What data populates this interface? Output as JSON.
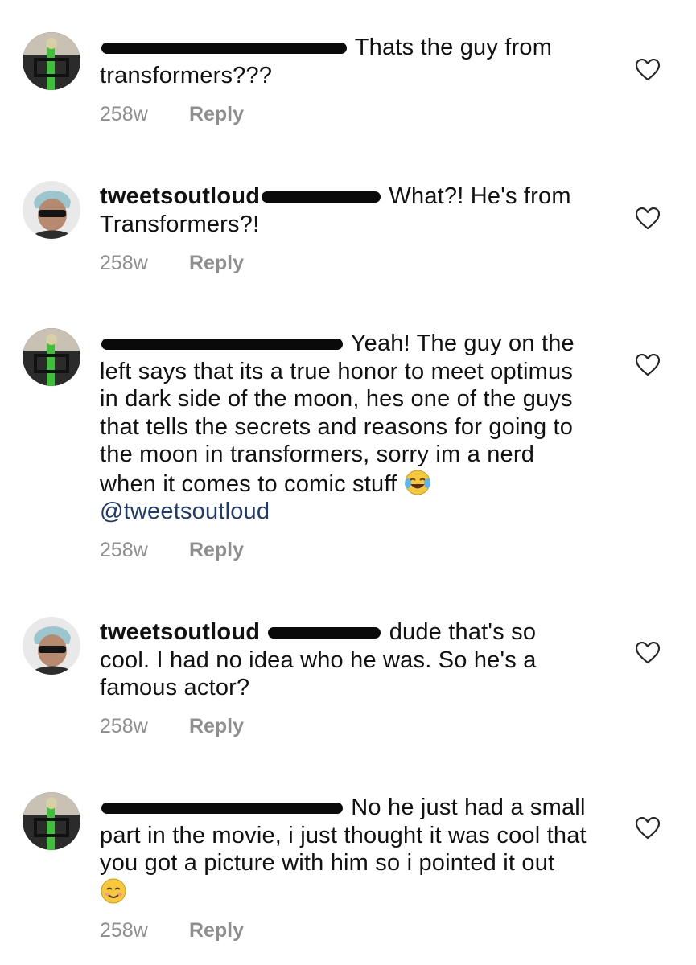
{
  "comments": [
    {
      "username": "",
      "text": "Thats the guy from transformers???",
      "time": "258w",
      "reply": "Reply",
      "avatar_icon": "user-avatar-green"
    },
    {
      "username": "tweetsoutloud",
      "text": "What?! He's from Transformers?!",
      "time": "258w",
      "reply": "Reply",
      "avatar_icon": "user-avatar-tweetsoutloud"
    },
    {
      "username": "",
      "text": "Yeah! The guy on the left says that its a true honor to meet optimus in dark side of the moon, hes one of the guys that tells the secrets and reasons for going to the moon in transformers, sorry im a nerd when it comes to comic stuff",
      "mention": "@tweetsoutloud",
      "emoji": "laughing-crying-emoji",
      "time": "258w",
      "reply": "Reply",
      "avatar_icon": "user-avatar-green"
    },
    {
      "username": "tweetsoutloud",
      "text": "dude that's so cool. I had no idea who he was. So he's a famous actor?",
      "time": "258w",
      "reply": "Reply",
      "avatar_icon": "user-avatar-tweetsoutloud"
    },
    {
      "username": "",
      "text": "No he just had a small part in the movie, i just thought it was cool that you got a picture with him so i pointed it out",
      "emoji": "smiling-emoji",
      "time": "258w",
      "reply": "Reply",
      "avatar_icon": "user-avatar-green"
    }
  ],
  "colors": {
    "text": "#111111",
    "meta": "#8e8e8e",
    "mention": "#1e3a6e",
    "redaction": "#0a0a0a"
  },
  "icons": {
    "like": "heart-outline-icon"
  }
}
